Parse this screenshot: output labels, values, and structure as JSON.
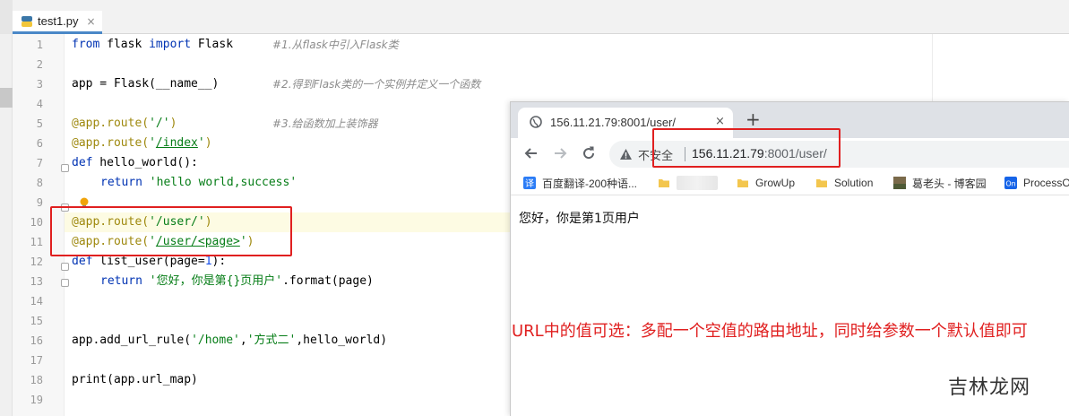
{
  "editor": {
    "tab_label": "test1.py",
    "line_numbers": [
      "1",
      "2",
      "3",
      "4",
      "5",
      "6",
      "7",
      "8",
      "9",
      "10",
      "11",
      "12",
      "13",
      "14",
      "15",
      "16",
      "17",
      "18",
      "19"
    ],
    "lines": {
      "l1": {
        "kw1": "from",
        "mod": " flask ",
        "kw2": "import",
        "cls": " Flask",
        "comment": "#1.从flask中引入Flask类"
      },
      "l3": {
        "code": "app = Flask(__name__)",
        "comment": "#2.得到Flask类的一个实例并定义一个函数"
      },
      "l5": {
        "dec": "@app.route(",
        "str": "'/'",
        "close": ")",
        "comment": "#3.给函数加上装饰器"
      },
      "l6": {
        "dec": "@app.route(",
        "q1": "'",
        "link": "/index",
        "q2": "'",
        "close": ")"
      },
      "l7": {
        "kw": "def",
        "rest": " hello_world():"
      },
      "l8": {
        "kw": "return",
        "str": " 'hello world,success'"
      },
      "l10": {
        "dec": "@app.route(",
        "str": "'/user/'",
        "close": ")"
      },
      "l11": {
        "dec": "@app.route(",
        "q1": "'",
        "link": "/user/<page>",
        "q2": "'",
        "close": ")"
      },
      "l12": {
        "kw": "def",
        "name": " list_user(page=",
        "num": "1",
        "close": "):"
      },
      "l13": {
        "kw": "return",
        "str": " '您好，你是第{}页用户'",
        "rest": ".format(page)"
      },
      "l16": {
        "pre": "app.add_url_rule(",
        "s1": "'/home'",
        "c1": ",",
        "s2": "'方式二'",
        "rest": ",hello_world)"
      },
      "l18": {
        "code": "print(app.url_map)"
      }
    }
  },
  "browser": {
    "tab_title": "156.11.21.79:8001/user/",
    "tab_close": "×",
    "new_tab": "+",
    "insecure_label": "不安全",
    "url_host": "156.11.21.79",
    "url_rest": ":8001/user/",
    "bookmarks": [
      {
        "label": "百度翻译-200种语...",
        "icon": "translate-icon"
      },
      {
        "label": "",
        "icon": "folder-icon"
      },
      {
        "label": "GrowUp",
        "icon": "folder-icon"
      },
      {
        "label": "Solution",
        "icon": "folder-icon"
      },
      {
        "label": "葛老头 - 博客园",
        "icon": "blog-avatar-icon"
      },
      {
        "label": "ProcessOn",
        "icon": "processon-icon"
      }
    ],
    "page_text": "您好，你是第1页用户"
  },
  "annotation": {
    "note": "URL中的值可选：多配一个空值的路由地址，同时给参数一个默认值即可",
    "watermark": "吉林龙网"
  },
  "colors": {
    "highlight_red": "#e02020",
    "keyword": "#0033b3",
    "string": "#067d17",
    "decorator": "#9e880d"
  }
}
